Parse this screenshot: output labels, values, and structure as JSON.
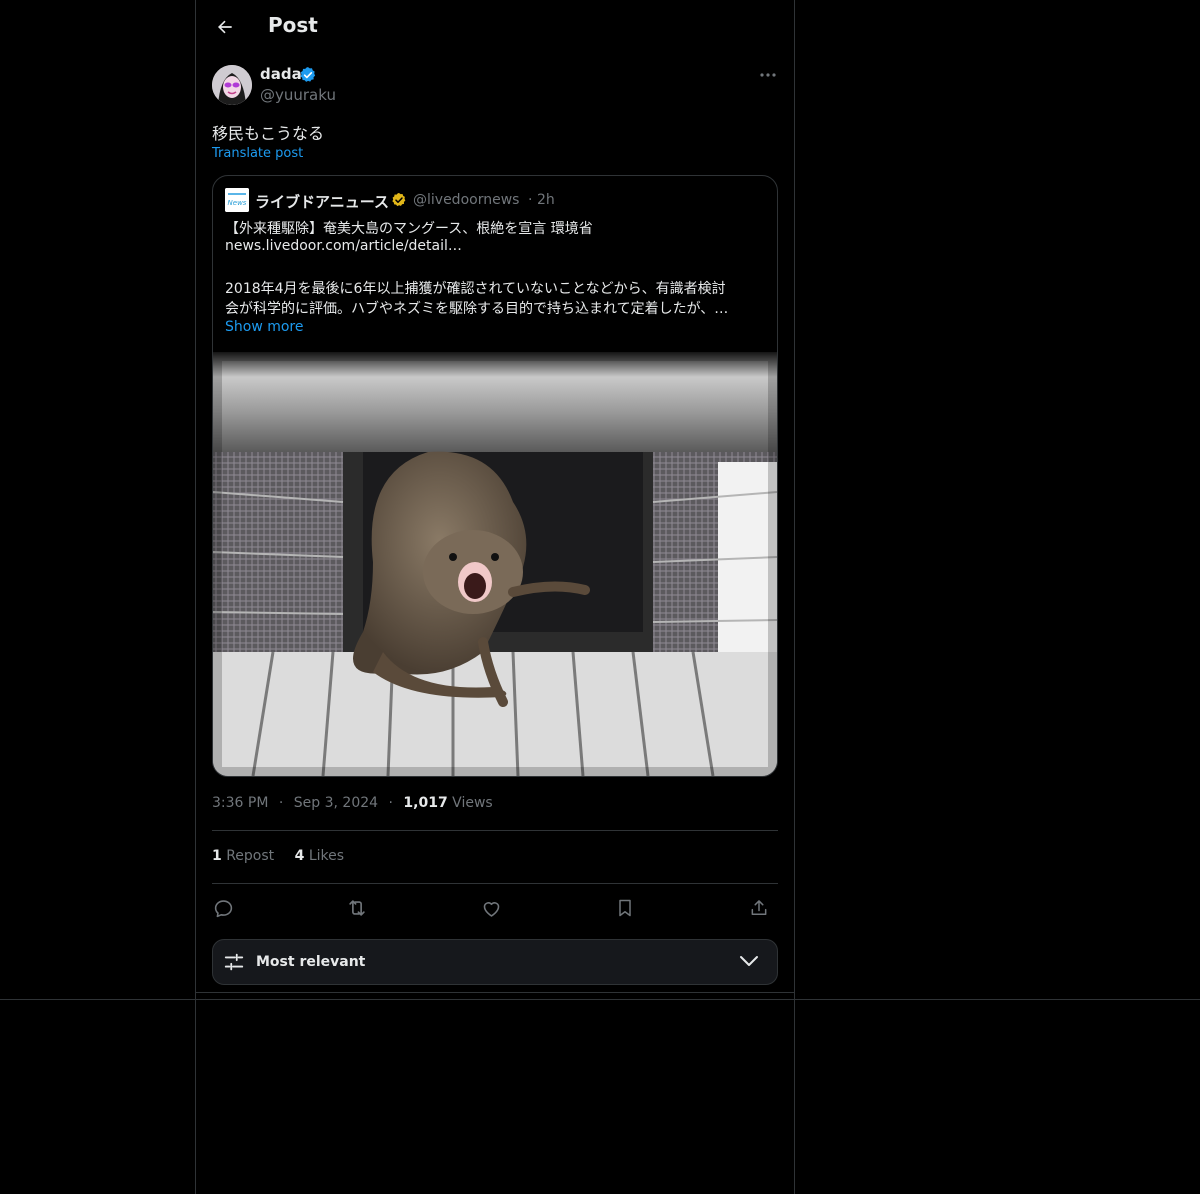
{
  "header": {
    "title": "Post"
  },
  "author": {
    "name": "dada",
    "handle": "@yuuraku"
  },
  "post": {
    "text": "移民もこうなる",
    "translate_label": "Translate post"
  },
  "quote": {
    "logo_text": "News",
    "name": "ライブドアニュース",
    "handle": "@livedoornews",
    "separator": "·",
    "time": "2h",
    "lines": [
      "【外来種駆除】奄美大島のマングース、根絶を宣言 環境省",
      "news.livedoor.com/article/detail…",
      "2018年4月を最後に6年以上捕獲が確認されていないことなどから、有識者検討",
      "会が科学的に評価。ハブやネズミを駆除する目的で持ち込まれて定着したが、…"
    ],
    "show_more": "Show more"
  },
  "meta": {
    "time": "3:36 PM",
    "dot": "·",
    "date": "Sep 3, 2024",
    "views_count": "1,017",
    "views_label": "Views"
  },
  "stats": {
    "reposts_count": "1",
    "reposts_label": "Repost",
    "likes_count": "4",
    "likes_label": "Likes"
  },
  "sort": {
    "label": "Most relevant"
  },
  "colors": {
    "background": "#000000",
    "accent": "#1d9bf0",
    "muted": "#71767b",
    "border": "#2f3336",
    "verified_gold": "#e2b719"
  },
  "icons": [
    "back-arrow-icon",
    "verified-badge-icon",
    "more-icon",
    "reply-icon",
    "repost-icon",
    "like-icon",
    "bookmark-icon",
    "share-icon",
    "sliders-icon",
    "chevron-down-icon"
  ]
}
